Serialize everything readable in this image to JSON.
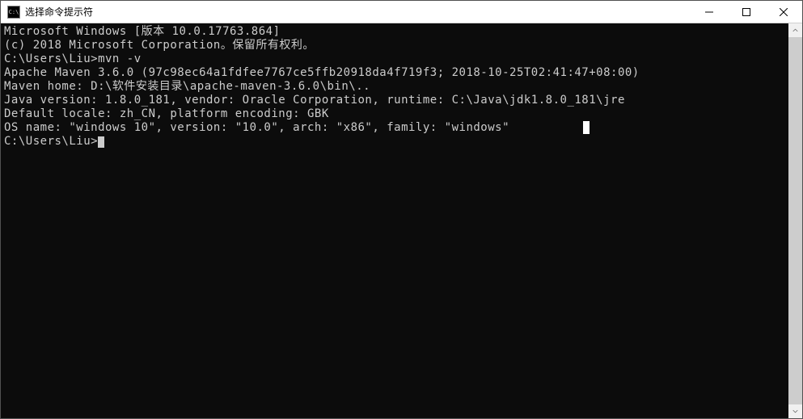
{
  "window": {
    "title": "选择命令提示符",
    "icon_label": "C:\\"
  },
  "terminal": {
    "lines": [
      "Microsoft Windows [版本 10.0.17763.864]",
      "(c) 2018 Microsoft Corporation。保留所有权利。",
      "",
      "C:\\Users\\Liu>mvn -v",
      "Apache Maven 3.6.0 (97c98ec64a1fdfee7767ce5ffb20918da4f719f3; 2018-10-25T02:41:47+08:00)",
      "Maven home: D:\\软件安装目录\\apache-maven-3.6.0\\bin\\..",
      "Java version: 1.8.0_181, vendor: Oracle Corporation, runtime: C:\\Java\\jdk1.8.0_181\\jre",
      "Default locale: zh_CN, platform encoding: GBK",
      "OS name: \"windows 10\", version: \"10.0\", arch: \"x86\", family: \"windows\"",
      "",
      "C:\\Users\\Liu>"
    ],
    "prompt_cursor_line_index": 10,
    "selection_line_index": 8
  }
}
